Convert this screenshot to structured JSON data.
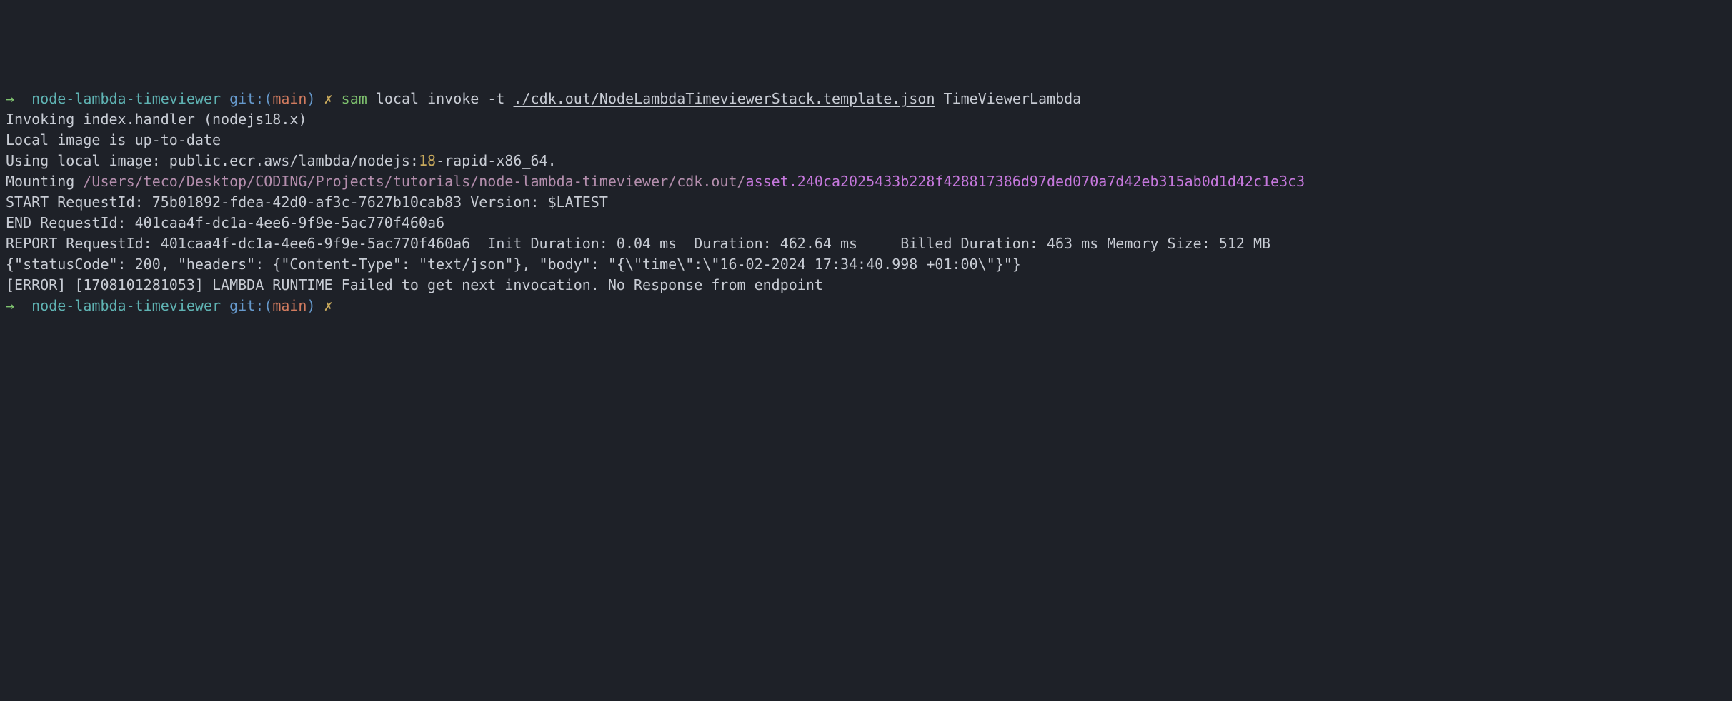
{
  "tab_highlight": "     ",
  "prompt1": {
    "arrow": "→",
    "dir": "node-lambda-timeviewer",
    "git": "git:(",
    "branch": "main",
    "close": ")",
    "x": "✗",
    "cmd": "sam",
    "args_pre": "local invoke -t ",
    "template_path": "./cdk.out/NodeLambdaTimeviewerStack.template.json",
    "args_post": " TimeViewerLambda"
  },
  "lines": {
    "invoking": "Invoking index.handler (nodejs18.x)",
    "local_image": "Local image is up-to-date",
    "using_local_pre": "Using local image: public.ecr.aws/lambda/nodejs:",
    "using_local_num": "18",
    "using_local_post": "-rapid-x86_64.",
    "blank": "",
    "mounting_label": "Mounting ",
    "mounting_path": "/Users/teco/Desktop/CODING/Projects/tutorials/node-lambda-timeviewer/cdk.out/",
    "mounting_asset": "asset.240ca2025433b228f428817386d97ded070a7d42eb315ab0d1d42c1e3c3",
    "start": "START RequestId: 75b01892-fdea-42d0-af3c-7627b10cab83 Version: $LATEST",
    "end": "END RequestId: 401caa4f-dc1a-4ee6-9f9e-5ac770f460a6",
    "report": "REPORT RequestId: 401caa4f-dc1a-4ee6-9f9e-5ac770f460a6  Init Duration: 0.04 ms  Duration: 462.64 ms     Billed Duration: 463 ms Memory Size: 512 MB",
    "response": "{\"statusCode\": 200, \"headers\": {\"Content-Type\": \"text/json\"}, \"body\": \"{\\\"time\\\":\\\"16-02-2024 17:34:40.998 +01:00\\\"}\"}",
    "error": "[ERROR] [1708101281053] LAMBDA_RUNTIME Failed to get next invocation. No Response from endpoint"
  },
  "prompt2": {
    "arrow": "→",
    "dir": "node-lambda-timeviewer",
    "git": "git:(",
    "branch": "main",
    "close": ")",
    "x": "✗"
  }
}
